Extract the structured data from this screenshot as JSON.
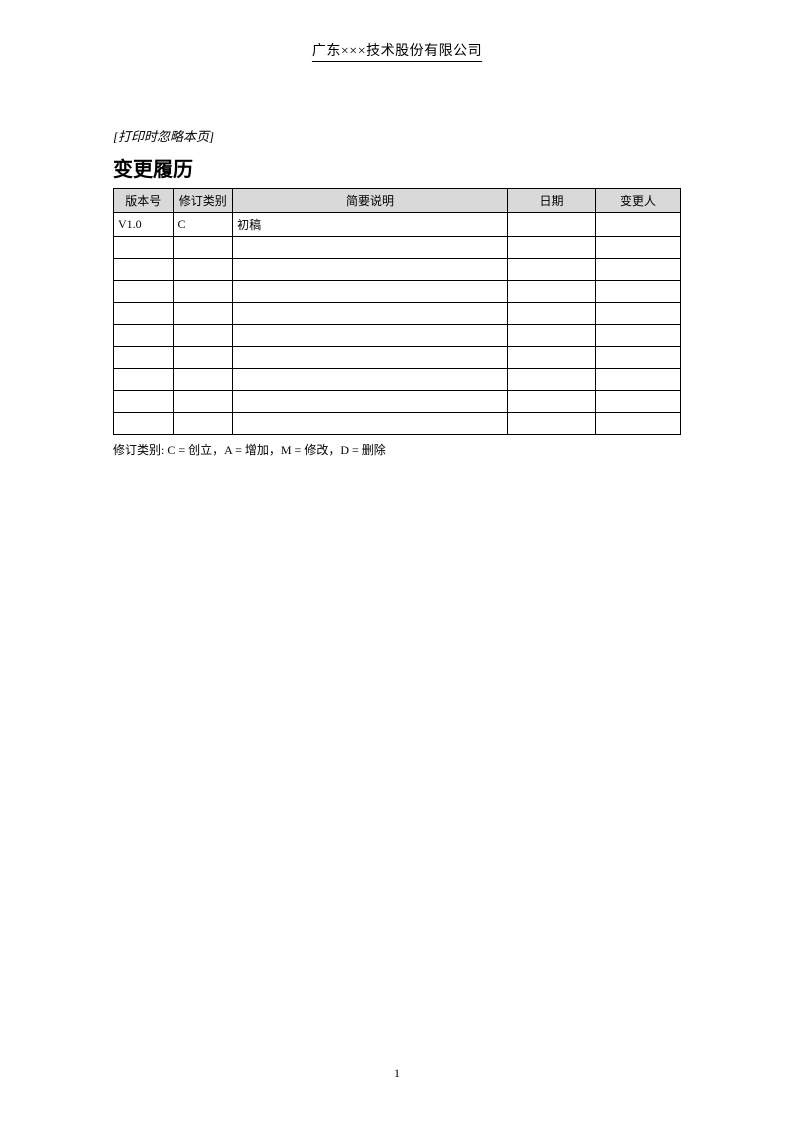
{
  "header": {
    "company": "广东×××技术股份有限公司"
  },
  "notes": {
    "skip_print": "[打印时忽略本页]"
  },
  "section": {
    "title": "变更履历"
  },
  "table": {
    "headers": {
      "version": "版本号",
      "rev_type": "修订类别",
      "summary": "简要说明",
      "date": "日期",
      "owner": "变更人"
    },
    "rows": [
      {
        "version": "V1.0",
        "rev_type": "C",
        "summary": "初稿",
        "date": "",
        "owner": ""
      },
      {
        "version": "",
        "rev_type": "",
        "summary": "",
        "date": "",
        "owner": ""
      },
      {
        "version": "",
        "rev_type": "",
        "summary": "",
        "date": "",
        "owner": ""
      },
      {
        "version": "",
        "rev_type": "",
        "summary": "",
        "date": "",
        "owner": ""
      },
      {
        "version": "",
        "rev_type": "",
        "summary": "",
        "date": "",
        "owner": ""
      },
      {
        "version": "",
        "rev_type": "",
        "summary": "",
        "date": "",
        "owner": ""
      },
      {
        "version": "",
        "rev_type": "",
        "summary": "",
        "date": "",
        "owner": ""
      },
      {
        "version": "",
        "rev_type": "",
        "summary": "",
        "date": "",
        "owner": ""
      },
      {
        "version": "",
        "rev_type": "",
        "summary": "",
        "date": "",
        "owner": ""
      },
      {
        "version": "",
        "rev_type": "",
        "summary": "",
        "date": "",
        "owner": ""
      }
    ]
  },
  "legend": {
    "text": "修订类别: C = 创立，A = 增加，M = 修改，D = 删除"
  },
  "footer": {
    "page_number": "1"
  }
}
